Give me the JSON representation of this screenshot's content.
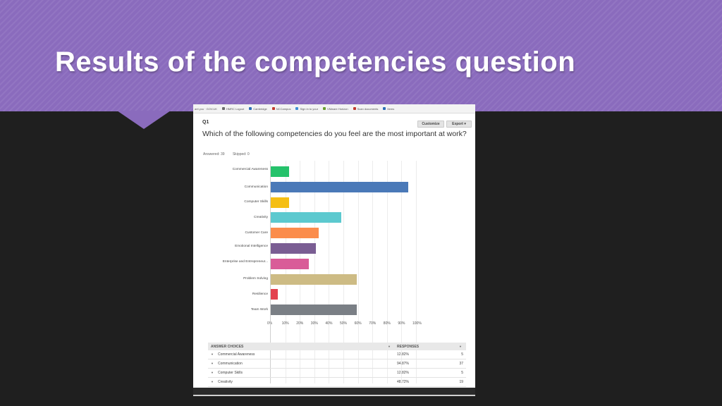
{
  "slide": {
    "title": "Results of the competencies question",
    "banner_color": "#8a6bbd",
    "background_color": "#1f1f1f"
  },
  "screenshot": {
    "bookmarks": [
      {
        "label": "ant you · GOV.UK",
        "color": "#1b7e3c"
      },
      {
        "label": "HMRC Logout",
        "color": "#6b6b6b"
      },
      {
        "label": "Cambridge",
        "color": "#2d6fb7"
      },
      {
        "label": "NCCampus",
        "color": "#c23a2e"
      },
      {
        "label": "Sign in to your",
        "color": "#3e8fd6"
      },
      {
        "label": "VMware Horizon",
        "color": "#6a9f2f"
      },
      {
        "label": "Scan documents",
        "color": "#c23a2e"
      },
      {
        "label": "Items",
        "color": "#2d6fb7"
      }
    ],
    "question_number": "Q1",
    "customize_label": "Customize",
    "export_label": "Export ▾",
    "question": "Which of the following competencies do you feel are the most important at work?",
    "answered_label": "Answered: 39",
    "skipped_label": "Skipped: 0",
    "table": {
      "headers": [
        "ANSWER CHOICES",
        "RESPONSES"
      ],
      "rows": [
        {
          "label": "Commercial Awareness",
          "percent": "12.82%",
          "count": "5"
        },
        {
          "label": "Communication",
          "percent": "94.87%",
          "count": "37"
        },
        {
          "label": "Computer Skills",
          "percent": "12.82%",
          "count": "5"
        },
        {
          "label": "Creativity",
          "percent": "48.72%",
          "count": "19"
        }
      ]
    }
  },
  "chart_data": {
    "type": "bar",
    "orientation": "horizontal",
    "categories": [
      "Commercial Awareness",
      "Communication",
      "Computer Skills",
      "Creativity",
      "Customer Care",
      "Emotional Intelligence",
      "Enterprise and Entrepreneur...",
      "Problem Solving",
      "Resilience",
      "Team Work"
    ],
    "values": [
      12.82,
      94.87,
      12.82,
      48.72,
      33,
      31,
      26,
      59,
      5,
      59
    ],
    "colors": [
      "#25c26b",
      "#4a79b8",
      "#f5bf14",
      "#5cc9cf",
      "#fb8c4c",
      "#7a5d93",
      "#d95c98",
      "#cdbb84",
      "#e3424f",
      "#7a7f85"
    ],
    "xticks": [
      "0%",
      "10%",
      "20%",
      "30%",
      "40%",
      "50%",
      "60%",
      "70%",
      "80%",
      "90%",
      "100%"
    ],
    "xlim": [
      0,
      100
    ],
    "grid": true
  }
}
